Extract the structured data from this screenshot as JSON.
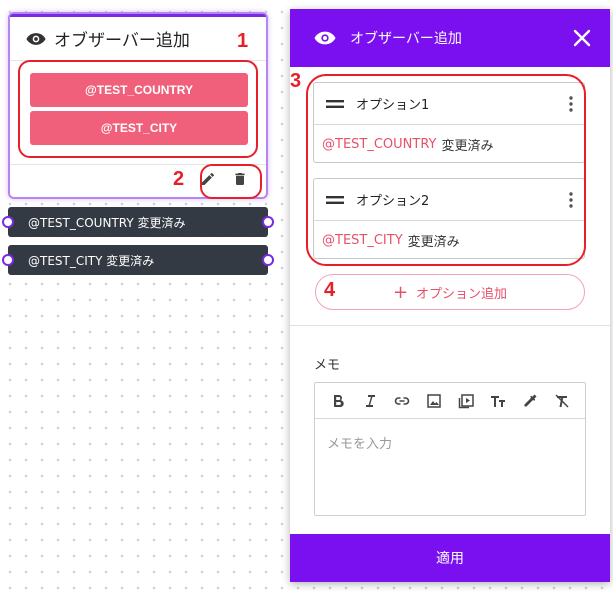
{
  "node": {
    "title": "オブザーバー追加",
    "icon": "eye-icon",
    "buttons": [
      "@TEST_COUNTRY",
      "@TEST_CITY"
    ],
    "actions": [
      "pencil-icon",
      "trash-icon"
    ],
    "outputs": [
      "@TEST_COUNTRY 変更済み",
      "@TEST_CITY 変更済み"
    ]
  },
  "annotations": [
    "1",
    "2",
    "3",
    "4"
  ],
  "panel": {
    "title": "オブザーバー追加",
    "options": [
      {
        "name": "オプション1",
        "variable": "@TEST_COUNTRY",
        "status": "変更済み"
      },
      {
        "name": "オプション2",
        "variable": "@TEST_CITY",
        "status": "変更済み"
      }
    ],
    "add_option_plus": "+",
    "add_option_label": "オプション追加",
    "memo_label": "メモ",
    "memo_placeholder": "メモを入力",
    "apply_label": "適用"
  },
  "colors": {
    "accent": "#7a0ff0",
    "pink": "#f0607a",
    "annotation_red": "#e6202a",
    "dark_pill": "#343a43"
  }
}
